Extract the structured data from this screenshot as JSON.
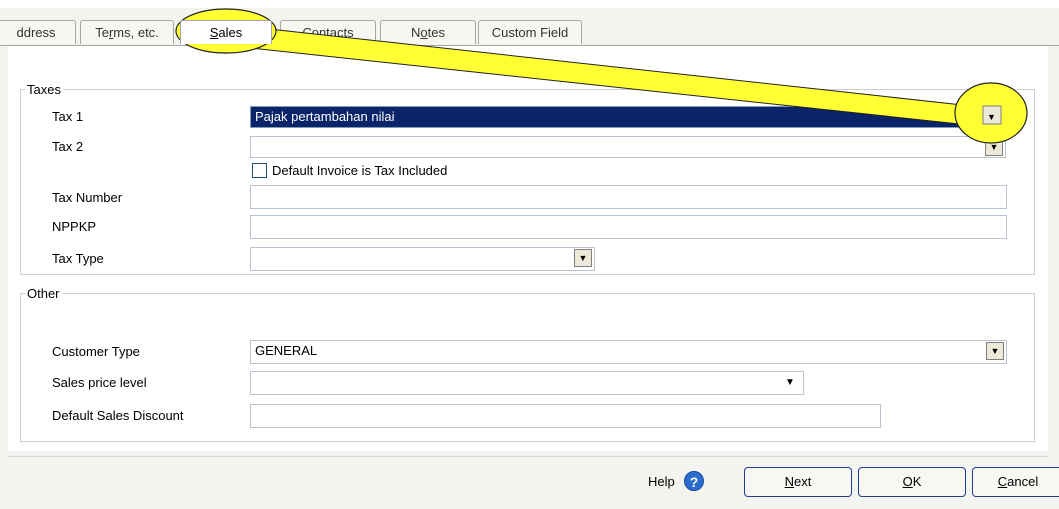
{
  "tabs": [
    {
      "id": "address",
      "label": "ddress"
    },
    {
      "id": "terms",
      "label": "Terms, etc."
    },
    {
      "id": "sales",
      "label": "Sales"
    },
    {
      "id": "contacts",
      "label": "Contacts"
    },
    {
      "id": "notes",
      "label": "Notes"
    },
    {
      "id": "custom",
      "label": "Custom Field"
    }
  ],
  "taxes": {
    "legend": "Taxes",
    "tax1_label": "Tax 1",
    "tax1_value": "Pajak pertambahan nilai",
    "tax2_label": "Tax 2",
    "tax2_value": "",
    "tax_included_label": "Default Invoice is Tax Included",
    "tax_included_checked": false,
    "tax_number_label": "Tax Number",
    "tax_number_value": "",
    "nppkp_label": "NPPKP",
    "nppkp_value": "",
    "tax_type_label": "Tax Type",
    "tax_type_value": ""
  },
  "other": {
    "legend": "Other",
    "customer_type_label": "Customer Type",
    "customer_type_value": "GENERAL",
    "price_level_label": "Sales price level",
    "price_level_value": "",
    "discount_label": "Default Sales Discount",
    "discount_value": ""
  },
  "footer": {
    "help_label": "Help",
    "help_icon": "question-mark",
    "next_label": "Next",
    "ok_label": "OK",
    "cancel_label": "Cancel"
  },
  "colors": {
    "highlight": "#ffff33",
    "selection": "#0a246a"
  }
}
